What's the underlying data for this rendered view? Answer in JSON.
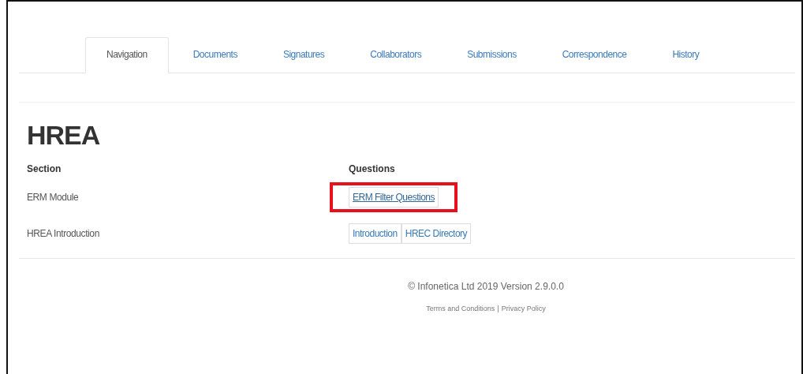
{
  "tabs": [
    {
      "label": "Navigation",
      "selected": true
    },
    {
      "label": "Documents",
      "selected": false
    },
    {
      "label": "Signatures",
      "selected": false
    },
    {
      "label": "Collaborators",
      "selected": false
    },
    {
      "label": "Submissions",
      "selected": false
    },
    {
      "label": "Correspondence",
      "selected": false
    },
    {
      "label": "History",
      "selected": false
    }
  ],
  "heading": "HREA",
  "table": {
    "columns": [
      "Section",
      "Questions"
    ],
    "rows": [
      {
        "section": "ERM Module",
        "highlighted": true,
        "questions": [
          "ERM Filter Questions"
        ]
      },
      {
        "section": "HREA Introduction",
        "highlighted": false,
        "questions": [
          "Introduction",
          "HREC Directory"
        ]
      }
    ]
  },
  "footer": {
    "copyright": "© Infonetica Ltd 2019 Version 2.9.0.0",
    "links": [
      "Terms and Conditions",
      "Privacy Policy"
    ],
    "separator": "|"
  }
}
